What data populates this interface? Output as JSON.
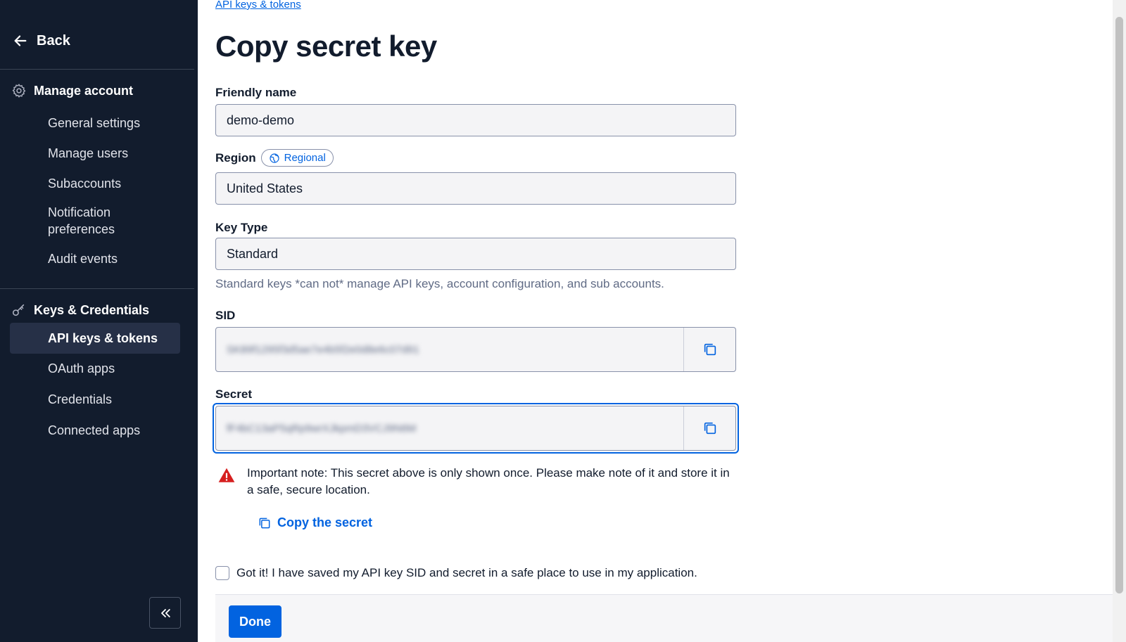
{
  "sidebar": {
    "back_label": "Back",
    "sections": [
      {
        "title": "Manage account",
        "icon": "gear-icon",
        "items": [
          "General settings",
          "Manage users",
          "Subaccounts",
          "Notification preferences",
          "Audit events"
        ]
      },
      {
        "title": "Keys & Credentials",
        "icon": "key-icon",
        "items": [
          "API keys & tokens",
          "OAuth apps",
          "Credentials",
          "Connected apps"
        ]
      }
    ],
    "active_item": "API keys & tokens"
  },
  "main": {
    "breadcrumb": "API keys & tokens",
    "title": "Copy secret key",
    "friendly_name": {
      "label": "Friendly name",
      "value": "demo-demo"
    },
    "region": {
      "label": "Region",
      "badge": "Regional",
      "value": "United States"
    },
    "key_type": {
      "label": "Key Type",
      "value": "Standard",
      "help": "Standard keys *can not* manage API keys, account configuration, and sub accounts."
    },
    "sid": {
      "label": "SID",
      "value": "SK89f1295f3d5ae7e4b5f2e0d8e6c07d91"
    },
    "secret": {
      "label": "Secret",
      "value": "fF4bC13aP5qRp9wrXJkpmD3VCJ9N6M"
    },
    "note": "Important note: This secret above is only shown once. Please make note of it and store it in a safe, secure location.",
    "copy_secret_label": "Copy the secret",
    "acknowledge_label": "Got it! I have saved my API key SID and secret in a safe place to use in my application.",
    "done_label": "Done"
  },
  "colors": {
    "sidebar_bg": "#121c2d",
    "accent": "#0263e0",
    "warning": "#d61f1f"
  }
}
